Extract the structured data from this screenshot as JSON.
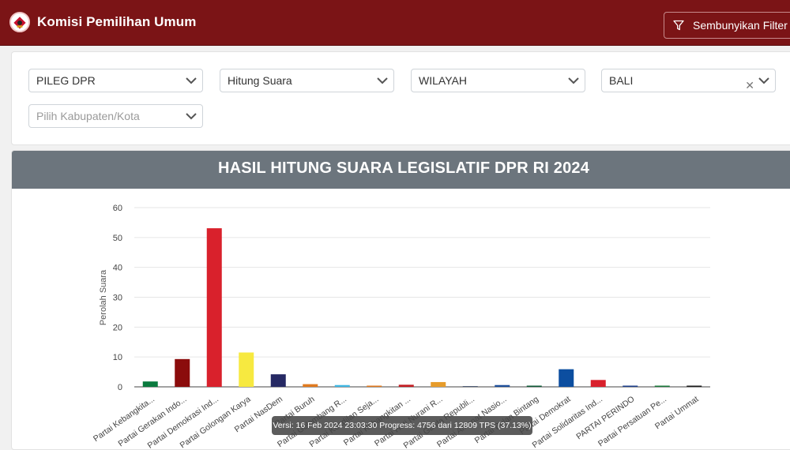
{
  "header": {
    "brand": "Komisi Pemilihan Umum",
    "filter_button": "Sembunyikan Filter",
    "icons": [
      "kpu-logo-icon",
      "filter-icon"
    ],
    "bg_color": "#7b1416"
  },
  "filters": {
    "election": "PILEG DPR",
    "mode": "Hitung Suara",
    "scope": "WILAYAH",
    "province": "BALI",
    "regency_placeholder": "Pilih Kabupaten/Kota"
  },
  "chart": {
    "title": "HASIL HITUNG SUARA LEGISLATIF DPR RI 2024",
    "header_color": "#6c757d"
  },
  "tooltip": {
    "text": "Versi: 16 Feb 2024 23:03:30 Progress: 4756 dari 12809 TPS (37.13%)"
  },
  "chart_data": {
    "type": "bar",
    "ylabel": "Perolah Suara",
    "xlabel": "",
    "ylim": [
      0,
      60
    ],
    "yticks": [
      0,
      10,
      20,
      30,
      40,
      50,
      60
    ],
    "grid": true,
    "categories": [
      "Partai Kebangkita...",
      "Partai Gerakan Indo...",
      "Partai Demokrasi Ind...",
      "Partai Golongan Karya",
      "Partai NasDem",
      "Partai Buruh",
      "Partai Gelombang R...",
      "Partai Keadilan Seja...",
      "Partai Kebangkitan ...",
      "Partai Hati Nurani R...",
      "Partai Garda Republi...",
      "Partai Amanat Nasio...",
      "Partai Bulan Bintang",
      "Partai Demokrat",
      "Partai Solidaritas Ind...",
      "PARTAI PERINDO",
      "Partai Persatuan Pe...",
      "Partai Ummat"
    ],
    "values": [
      1.8,
      9.3,
      53.1,
      11.5,
      4.2,
      0.9,
      0.6,
      0.4,
      0.7,
      1.6,
      0.2,
      0.6,
      0.4,
      5.9,
      2.3,
      0.4,
      0.4,
      0.4
    ],
    "colors": [
      "#0a7a3e",
      "#8b0c0c",
      "#d9212c",
      "#f7e940",
      "#262964",
      "#e07a1f",
      "#3fb7e3",
      "#e07a1f",
      "#c41e24",
      "#e79c2b",
      "#1b2a4a",
      "#1d4f9a",
      "#0f5a36",
      "#0c4ea0",
      "#d9212c",
      "#1d3e8a",
      "#1b7a3a",
      "#1a1a1a"
    ]
  }
}
